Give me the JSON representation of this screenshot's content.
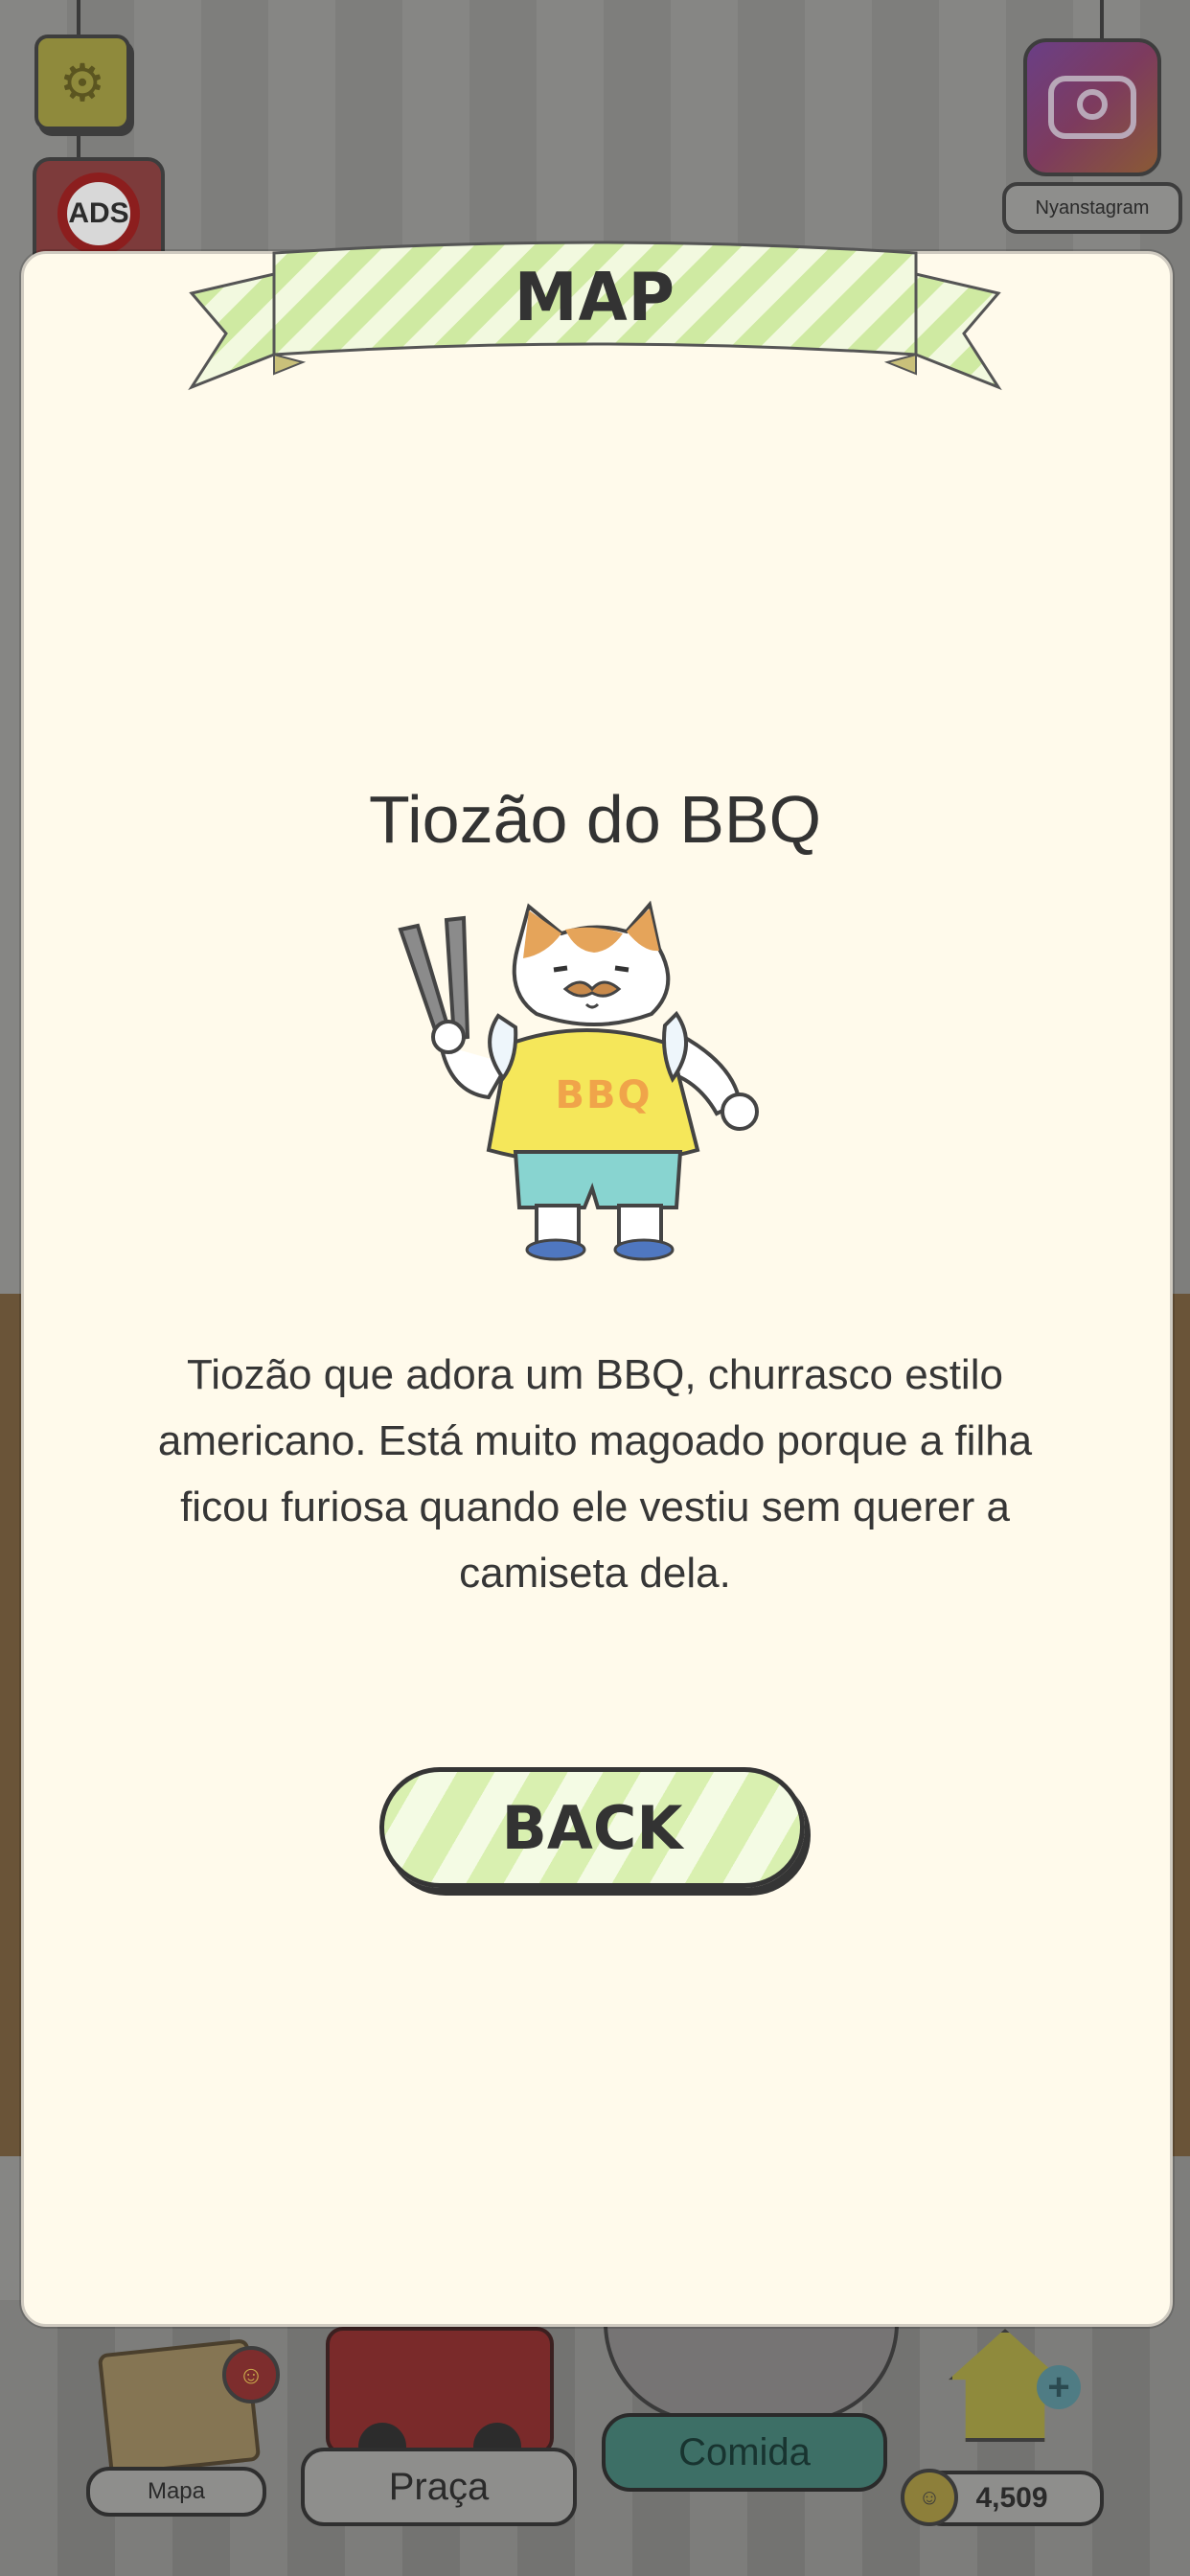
{
  "background": {
    "instagram_label": "Nyanstagram",
    "ads_label": "ADS",
    "nav": {
      "mapa_label": "Mapa",
      "praca_label": "Praça",
      "comida_label": "Comida",
      "coins": "4,509"
    }
  },
  "modal": {
    "banner_title": "MAP",
    "character_name": "Tiozão do BBQ",
    "shirt_text": "BBQ",
    "description": "Tiozão que adora um BBQ, churrasco estilo americano. Está muito magoado porque a filha ficou furiosa quando ele vestiu sem querer a camiseta dela.",
    "back_label": "BACK"
  },
  "colors": {
    "modal_bg": "#fffaeb",
    "accent_green": "#d9f0b0",
    "text_dark": "#333333"
  }
}
